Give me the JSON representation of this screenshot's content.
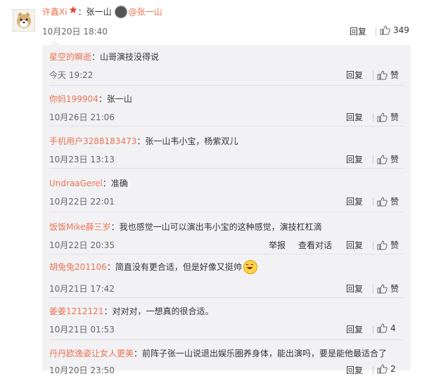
{
  "main_comment": {
    "user": "许鑫Xi",
    "badge_icon": "star-badge",
    "text": "张一山",
    "mention": "@张一山",
    "time": "10月20日 18:40",
    "reply_label": "回复",
    "like_count": "349"
  },
  "replies": [
    {
      "user": "星空的瞬逝",
      "text": "山哥演技没得说",
      "time": "今天 19:22",
      "reply_label": "回复",
      "like": "赞"
    },
    {
      "user": "你妈199904",
      "text": "张一山",
      "time": "10月26日 21:06",
      "reply_label": "回复",
      "like": "赞"
    },
    {
      "user": "手机用户3288183473",
      "text": "张一山韦小宝，杨紫双儿",
      "time": "10月23日 13:13",
      "reply_label": "回复",
      "like": "赞"
    },
    {
      "user": "UndraaGerel",
      "text": "准确",
      "time": "10月22日 22:01",
      "reply_label": "回复",
      "like": "赞"
    },
    {
      "user": "饭饭Mike薛三岁",
      "text": "我也感觉一山可以演出韦小宝的这种感觉，演技杠杠滴",
      "time": "10月22日 20:35",
      "report_label": "举报",
      "view_label": "查看对话",
      "reply_label": "回复",
      "like": "赞"
    },
    {
      "user": "胡兔兔201106",
      "text": "简直没有更合适，但是好像又挺帅",
      "time": "10月21日 17:42",
      "reply_label": "回复",
      "like": "赞",
      "emoji": "laughing-emoji"
    },
    {
      "user": "姜姜1212121",
      "text": "对对对，一想真的很合适。",
      "time": "10月21日 01:53",
      "reply_label": "回复",
      "like": "4"
    },
    {
      "user": "丹丹欧逸姿让女人更美",
      "text": "前阵子张一山说退出娱乐圈养身体，能出演吗，要是能他最适合了",
      "time": "10月20日 23:50",
      "reply_label": "回复",
      "like": "2"
    }
  ]
}
